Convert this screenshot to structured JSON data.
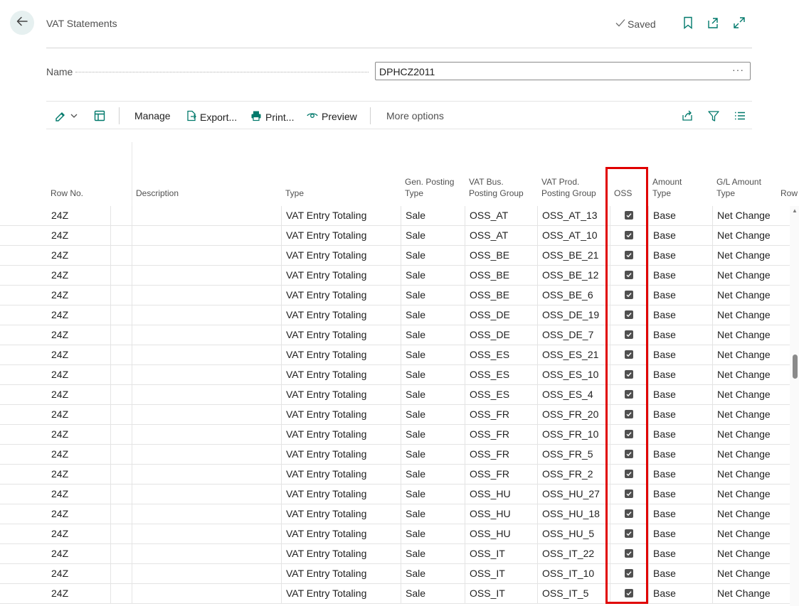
{
  "header": {
    "title": "VAT Statements",
    "status": "Saved"
  },
  "name_field": {
    "label": "Name",
    "value": "DPHCZ2011",
    "more": "···"
  },
  "actions": {
    "manage": "Manage",
    "export": "Export...",
    "print": "Print...",
    "preview": "Preview",
    "more_options": "More options"
  },
  "columns": {
    "row_no": "Row No.",
    "description": "Description",
    "type": "Type",
    "gen_posting_type_1": "Gen. Posting",
    "gen_posting_type_2": "Type",
    "vat_bus_1": "VAT Bus.",
    "vat_bus_2": "Posting Group",
    "vat_prod_1": "VAT Prod.",
    "vat_prod_2": "Posting Group",
    "oss": "OSS",
    "amount_type_1": "Amount",
    "amount_type_2": "Type",
    "gl_amount_type_1": "G/L Amount",
    "gl_amount_type_2": "Type",
    "row_totaling": "Row"
  },
  "rows": [
    {
      "row_no": "24Z",
      "type": "VAT Entry Totaling",
      "gen_posting_type": "Sale",
      "vat_bus": "OSS_AT",
      "vat_prod": "OSS_AT_13",
      "oss": true,
      "amount_type": "Base",
      "gl_amount_type": "Net Change"
    },
    {
      "row_no": "24Z",
      "type": "VAT Entry Totaling",
      "gen_posting_type": "Sale",
      "vat_bus": "OSS_AT",
      "vat_prod": "OSS_AT_10",
      "oss": true,
      "amount_type": "Base",
      "gl_amount_type": "Net Change"
    },
    {
      "row_no": "24Z",
      "type": "VAT Entry Totaling",
      "gen_posting_type": "Sale",
      "vat_bus": "OSS_BE",
      "vat_prod": "OSS_BE_21",
      "oss": true,
      "amount_type": "Base",
      "gl_amount_type": "Net Change"
    },
    {
      "row_no": "24Z",
      "type": "VAT Entry Totaling",
      "gen_posting_type": "Sale",
      "vat_bus": "OSS_BE",
      "vat_prod": "OSS_BE_12",
      "oss": true,
      "amount_type": "Base",
      "gl_amount_type": "Net Change"
    },
    {
      "row_no": "24Z",
      "type": "VAT Entry Totaling",
      "gen_posting_type": "Sale",
      "vat_bus": "OSS_BE",
      "vat_prod": "OSS_BE_6",
      "oss": true,
      "amount_type": "Base",
      "gl_amount_type": "Net Change"
    },
    {
      "row_no": "24Z",
      "type": "VAT Entry Totaling",
      "gen_posting_type": "Sale",
      "vat_bus": "OSS_DE",
      "vat_prod": "OSS_DE_19",
      "oss": true,
      "amount_type": "Base",
      "gl_amount_type": "Net Change"
    },
    {
      "row_no": "24Z",
      "type": "VAT Entry Totaling",
      "gen_posting_type": "Sale",
      "vat_bus": "OSS_DE",
      "vat_prod": "OSS_DE_7",
      "oss": true,
      "amount_type": "Base",
      "gl_amount_type": "Net Change"
    },
    {
      "row_no": "24Z",
      "type": "VAT Entry Totaling",
      "gen_posting_type": "Sale",
      "vat_bus": "OSS_ES",
      "vat_prod": "OSS_ES_21",
      "oss": true,
      "amount_type": "Base",
      "gl_amount_type": "Net Change"
    },
    {
      "row_no": "24Z",
      "type": "VAT Entry Totaling",
      "gen_posting_type": "Sale",
      "vat_bus": "OSS_ES",
      "vat_prod": "OSS_ES_10",
      "oss": true,
      "amount_type": "Base",
      "gl_amount_type": "Net Change"
    },
    {
      "row_no": "24Z",
      "type": "VAT Entry Totaling",
      "gen_posting_type": "Sale",
      "vat_bus": "OSS_ES",
      "vat_prod": "OSS_ES_4",
      "oss": true,
      "amount_type": "Base",
      "gl_amount_type": "Net Change"
    },
    {
      "row_no": "24Z",
      "type": "VAT Entry Totaling",
      "gen_posting_type": "Sale",
      "vat_bus": "OSS_FR",
      "vat_prod": "OSS_FR_20",
      "oss": true,
      "amount_type": "Base",
      "gl_amount_type": "Net Change"
    },
    {
      "row_no": "24Z",
      "type": "VAT Entry Totaling",
      "gen_posting_type": "Sale",
      "vat_bus": "OSS_FR",
      "vat_prod": "OSS_FR_10",
      "oss": true,
      "amount_type": "Base",
      "gl_amount_type": "Net Change"
    },
    {
      "row_no": "24Z",
      "type": "VAT Entry Totaling",
      "gen_posting_type": "Sale",
      "vat_bus": "OSS_FR",
      "vat_prod": "OSS_FR_5",
      "oss": true,
      "amount_type": "Base",
      "gl_amount_type": "Net Change"
    },
    {
      "row_no": "24Z",
      "type": "VAT Entry Totaling",
      "gen_posting_type": "Sale",
      "vat_bus": "OSS_FR",
      "vat_prod": "OSS_FR_2",
      "oss": true,
      "amount_type": "Base",
      "gl_amount_type": "Net Change"
    },
    {
      "row_no": "24Z",
      "type": "VAT Entry Totaling",
      "gen_posting_type": "Sale",
      "vat_bus": "OSS_HU",
      "vat_prod": "OSS_HU_27",
      "oss": true,
      "amount_type": "Base",
      "gl_amount_type": "Net Change"
    },
    {
      "row_no": "24Z",
      "type": "VAT Entry Totaling",
      "gen_posting_type": "Sale",
      "vat_bus": "OSS_HU",
      "vat_prod": "OSS_HU_18",
      "oss": true,
      "amount_type": "Base",
      "gl_amount_type": "Net Change"
    },
    {
      "row_no": "24Z",
      "type": "VAT Entry Totaling",
      "gen_posting_type": "Sale",
      "vat_bus": "OSS_HU",
      "vat_prod": "OSS_HU_5",
      "oss": true,
      "amount_type": "Base",
      "gl_amount_type": "Net Change"
    },
    {
      "row_no": "24Z",
      "type": "VAT Entry Totaling",
      "gen_posting_type": "Sale",
      "vat_bus": "OSS_IT",
      "vat_prod": "OSS_IT_22",
      "oss": true,
      "amount_type": "Base",
      "gl_amount_type": "Net Change"
    },
    {
      "row_no": "24Z",
      "type": "VAT Entry Totaling",
      "gen_posting_type": "Sale",
      "vat_bus": "OSS_IT",
      "vat_prod": "OSS_IT_10",
      "oss": true,
      "amount_type": "Base",
      "gl_amount_type": "Net Change"
    },
    {
      "row_no": "24Z",
      "type": "VAT Entry Totaling",
      "gen_posting_type": "Sale",
      "vat_bus": "OSS_IT",
      "vat_prod": "OSS_IT_5",
      "oss": true,
      "amount_type": "Base",
      "gl_amount_type": "Net Change"
    }
  ],
  "colors": {
    "accent": "#00796b",
    "highlight": "#e00000"
  }
}
